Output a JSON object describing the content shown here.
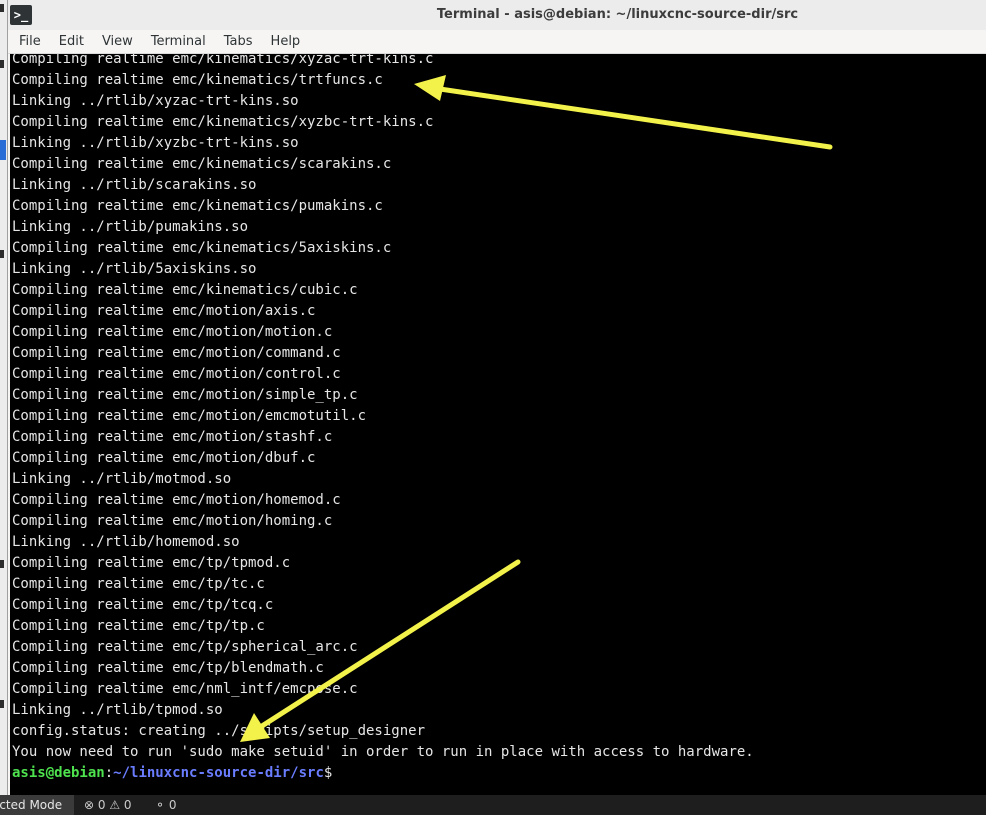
{
  "window": {
    "title": "Terminal - asis@debian: ~/linuxcnc-source-dir/src",
    "icon_glyph": ">_"
  },
  "menu": {
    "items": [
      "File",
      "Edit",
      "View",
      "Terminal",
      "Tabs",
      "Help"
    ]
  },
  "terminal": {
    "lines": [
      "Compiling realtime emc/kinematics/xyzac-trt-kins.c",
      "Compiling realtime emc/kinematics/trtfuncs.c",
      "Linking ../rtlib/xyzac-trt-kins.so",
      "Compiling realtime emc/kinematics/xyzbc-trt-kins.c",
      "Linking ../rtlib/xyzbc-trt-kins.so",
      "Compiling realtime emc/kinematics/scarakins.c",
      "Linking ../rtlib/scarakins.so",
      "Compiling realtime emc/kinematics/pumakins.c",
      "Linking ../rtlib/pumakins.so",
      "Compiling realtime emc/kinematics/5axiskins.c",
      "Linking ../rtlib/5axiskins.so",
      "Compiling realtime emc/kinematics/cubic.c",
      "Compiling realtime emc/motion/axis.c",
      "Compiling realtime emc/motion/motion.c",
      "Compiling realtime emc/motion/command.c",
      "Compiling realtime emc/motion/control.c",
      "Compiling realtime emc/motion/simple_tp.c",
      "Compiling realtime emc/motion/emcmotutil.c",
      "Compiling realtime emc/motion/stashf.c",
      "Compiling realtime emc/motion/dbuf.c",
      "Linking ../rtlib/motmod.so",
      "Compiling realtime emc/motion/homemod.c",
      "Compiling realtime emc/motion/homing.c",
      "Linking ../rtlib/homemod.so",
      "Compiling realtime emc/tp/tpmod.c",
      "Compiling realtime emc/tp/tc.c",
      "Compiling realtime emc/tp/tcq.c",
      "Compiling realtime emc/tp/tp.c",
      "Compiling realtime emc/tp/spherical_arc.c",
      "Compiling realtime emc/tp/blendmath.c",
      "Compiling realtime emc/nml_intf/emcpose.c",
      "Linking ../rtlib/tpmod.so",
      "config.status: creating ../scripts/setup_designer",
      "You now need to run 'sudo make setuid' in order to run in place with access to hardware."
    ],
    "prompt": {
      "user_host": "asis@debian",
      "separator": ":",
      "path": "~/linuxcnc-source-dir/src",
      "symbol": "$"
    },
    "colors": {
      "background": "#000000",
      "text": "#e6e6e6",
      "prompt_user": "#4ee24e",
      "prompt_path": "#6a7dff"
    }
  },
  "annotations": {
    "arrow_color": "#f2f24a"
  },
  "statusbar": {
    "mode": "icted Mode",
    "problems": "⊗ 0 ⚠ 0",
    "ports": "⚬ 0"
  }
}
